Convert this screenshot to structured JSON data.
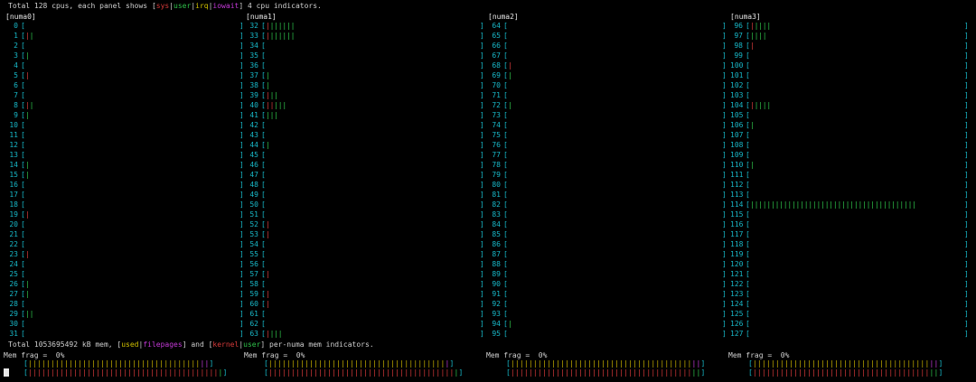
{
  "header": {
    "cpu_summary_prefix": "Total 128 cpus, each panel shows [",
    "sys": "sys",
    "sep1": "|",
    "user": "user",
    "sep2": "|",
    "irq": "irq",
    "sep3": "|",
    "iowait": "iowait",
    "cpu_summary_suffix": "] 4 cpu indicators.",
    "mem_summary_prefix": "Total 1053695492 kB mem, [",
    "used": "used",
    "sep4": "|",
    "filepages": "filepages",
    "mem_summary_mid": "] and [",
    "kernel": "kernel",
    "sep5": "|",
    "userm": "user",
    "mem_summary_suffix": "] per-numa mem indicators."
  },
  "colors": {
    "cyan": "#18b8c8",
    "sys": "#d83a3a",
    "user": "#2ec24a",
    "irq": "#c8b000",
    "iowait": "#c43ad8"
  },
  "panels": [
    {
      "title": "[numa0]",
      "start": 0,
      "bars": {
        "1": "SU",
        "3": "U",
        "5": "S",
        "8": "SU",
        "9": "U",
        "14": "U",
        "15": "U",
        "19": "S",
        "23": "S",
        "26": "U",
        "27": "U",
        "29": "UU"
      }
    },
    {
      "title": "[numa1]",
      "start": 32,
      "bars": {
        "32": "SUUUUUU",
        "33": "SUUUUUU",
        "37": "U",
        "38": "U",
        "39": "SUU",
        "40": "SSUUU",
        "41": "UUU",
        "44": "U",
        "52": "S",
        "53": "S",
        "57": "S",
        "59": "S",
        "60": "S",
        "63": "SUUU"
      }
    },
    {
      "title": "[numa2]",
      "start": 64,
      "bars": {
        "68": "S",
        "69": "U",
        "72": "U",
        "94": "U"
      }
    },
    {
      "title": "[numa3]",
      "start": 96,
      "bars": {
        "96": "SUUUU",
        "97": "UUUU",
        "98": "S",
        "104": "SUUUU",
        "106": "U",
        "110": "U",
        "114": "UUUUUUUUUUUUUUUUUUUUUUUUUUUUUUUUUUUUUUUU"
      }
    }
  ],
  "mem": [
    {
      "frag_label": "Mem frag =",
      "frag_value": "0%"
    },
    {
      "frag_label": "Mem frag =",
      "frag_value": "0%"
    },
    {
      "frag_label": "Mem frag =",
      "frag_value": "0%"
    },
    {
      "frag_label": "Mem frag =",
      "frag_value": "0%"
    }
  ],
  "mem_bars": [
    {
      "top_used": 38,
      "top_file": 2,
      "bot_kern": 42,
      "bot_user": 1
    },
    {
      "top_used": 39,
      "top_file": 1,
      "bot_kern": 41,
      "bot_user": 1
    },
    {
      "top_used": 40,
      "top_file": 2,
      "bot_kern": 40,
      "bot_user": 2
    },
    {
      "top_used": 39,
      "top_file": 2,
      "bot_kern": 39,
      "bot_user": 2
    }
  ]
}
